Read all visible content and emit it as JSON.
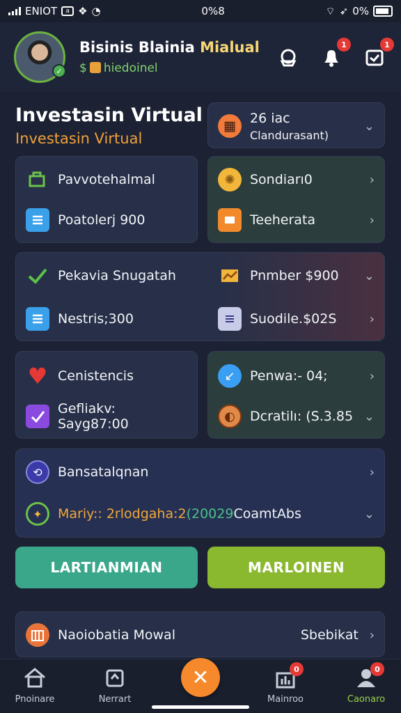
{
  "status_bar": {
    "carrier": "ENIOT",
    "time": "0%8",
    "battery": "0%"
  },
  "header": {
    "title_main": "Bisinis Blainia ",
    "title_accent": "Mialual",
    "subtitle_prefix": "$",
    "subtitle": "hiedoinel",
    "bell_badge": "1",
    "inbox_badge": "1"
  },
  "hero": {
    "title": "Investasin Virtual",
    "subtitle": "Investasin Virtual"
  },
  "top_card": {
    "label": "26 iac",
    "sublabel": "Clandurasant)"
  },
  "cards": [
    {
      "label": "Pavvotehalmal"
    },
    {
      "label": "Poatolerj 900"
    },
    {
      "label": "Sondiarı0"
    },
    {
      "label": "Teeherata"
    },
    {
      "label": "Pekavia Snugatah"
    },
    {
      "label": "Nestris;300"
    },
    {
      "label": "Pnmber $900"
    },
    {
      "label": "Suodile.$02S"
    },
    {
      "label": "Cenistencis"
    },
    {
      "label": "Gefliakv: Sayg87:00"
    },
    {
      "label": "Penwa:- 04;"
    },
    {
      "label": "Dcratilı: (S.3.85"
    },
    {
      "label": "Bansatalqnan"
    }
  ],
  "rich_row": {
    "part1": "Mariy:: 2rlodgaha:2 ",
    "part2": "(20029",
    "part3": " CoamtAbs"
  },
  "buttons": {
    "left": "LARTIANMIAN",
    "right": "MARLOINEN"
  },
  "bottom_card": {
    "label": "Naoiobatia Mowal",
    "value": "Sbebikat"
  },
  "tabs": [
    {
      "label": "Pnoinare"
    },
    {
      "label": "Nerrart"
    },
    {
      "label": "Mainroo",
      "badge": "0"
    },
    {
      "label": "Caonaro",
      "badge": "0"
    }
  ],
  "fab_symbol": "✕"
}
